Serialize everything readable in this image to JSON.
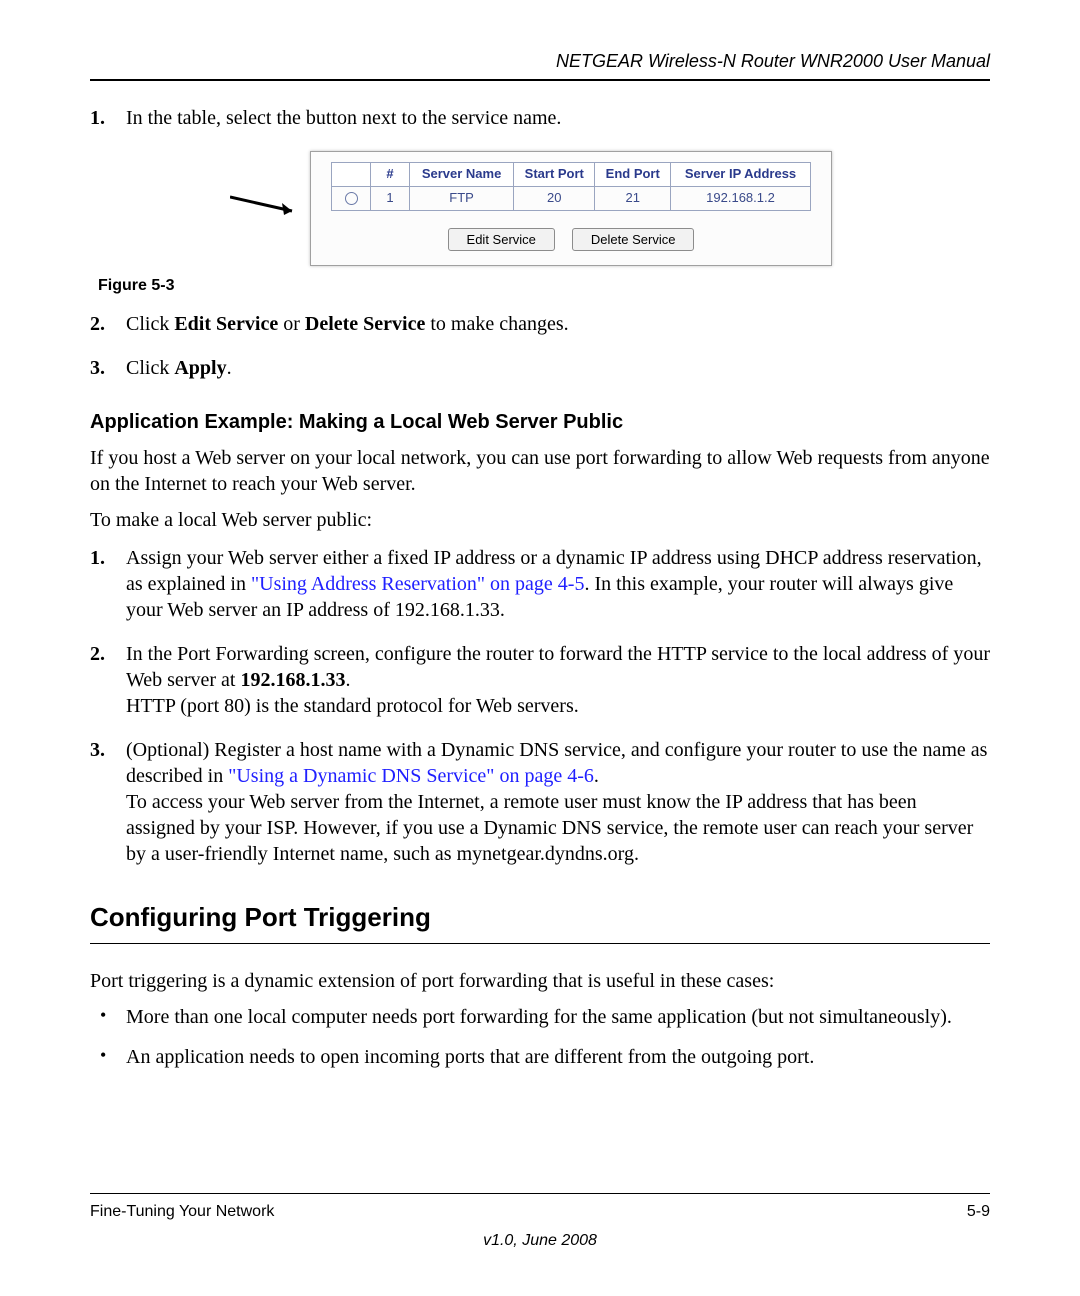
{
  "header": {
    "running_title": "NETGEAR Wireless-N Router WNR2000 User Manual"
  },
  "list1": {
    "item1_num": "1.",
    "item1_text": "In the table, select the button next to the service name."
  },
  "figure": {
    "caption": "Figure 5-3",
    "table": {
      "headers": [
        "#",
        "Server Name",
        "Start Port",
        "End Port",
        "Server IP Address"
      ],
      "row": {
        "index": "1",
        "server": "FTP",
        "start": "20",
        "end": "21",
        "ip": "192.168.1.2"
      }
    },
    "buttons": {
      "edit": "Edit Service",
      "delete": "Delete Service"
    }
  },
  "list2": {
    "item2_num": "2.",
    "item2_a": "Click ",
    "item2_b": "Edit Service",
    "item2_c": " or ",
    "item2_d": "Delete Service",
    "item2_e": " to make changes.",
    "item3_num": "3.",
    "item3_a": "Click ",
    "item3_b": "Apply",
    "item3_c": "."
  },
  "subheading": "Application Example: Making a Local Web Server Public",
  "para1": "If you host a Web server on your local network, you can use port forwarding to allow Web requests from anyone on the Internet to reach your Web server.",
  "para2": "To make a local Web server public:",
  "steps": {
    "s1_num": "1.",
    "s1_a": "Assign your Web server either a fixed IP address or a dynamic IP address using DHCP address reservation, as explained in ",
    "s1_link": "\"Using Address Reservation\" on page 4-5",
    "s1_b": ". In this example, your router will always give your Web server an IP address of 192.168.1.33.",
    "s2_num": "2.",
    "s2_a": "In the Port Forwarding screen, configure the router to forward the HTTP service to the local address of your Web server at ",
    "s2_b": "192.168.1.33",
    "s2_c": ".",
    "s2_d": "HTTP (port 80) is the standard protocol for Web servers.",
    "s3_num": "3.",
    "s3_a": "(Optional) Register a host name with a Dynamic DNS service, and configure your router to use the name as described in ",
    "s3_link": "\"Using a Dynamic DNS Service\" on page 4-6",
    "s3_b": ".",
    "s3_c": "To access your Web server from the Internet, a remote user must know the IP address that has been assigned by your ISP. However, if you use a Dynamic DNS service, the remote user can reach your server by a user-friendly Internet name, such as mynetgear.dyndns.org."
  },
  "section_heading": "Configuring Port Triggering",
  "para3": "Port triggering is a dynamic extension of port forwarding that is useful in these cases:",
  "bullets": {
    "b1": "More than one local computer needs port forwarding for the same application (but not simultaneously).",
    "b2": "An application needs to open incoming ports that are different from the outgoing port."
  },
  "footer": {
    "left": "Fine-Tuning Your Network",
    "right": "5-9",
    "version": "v1.0, June 2008"
  }
}
